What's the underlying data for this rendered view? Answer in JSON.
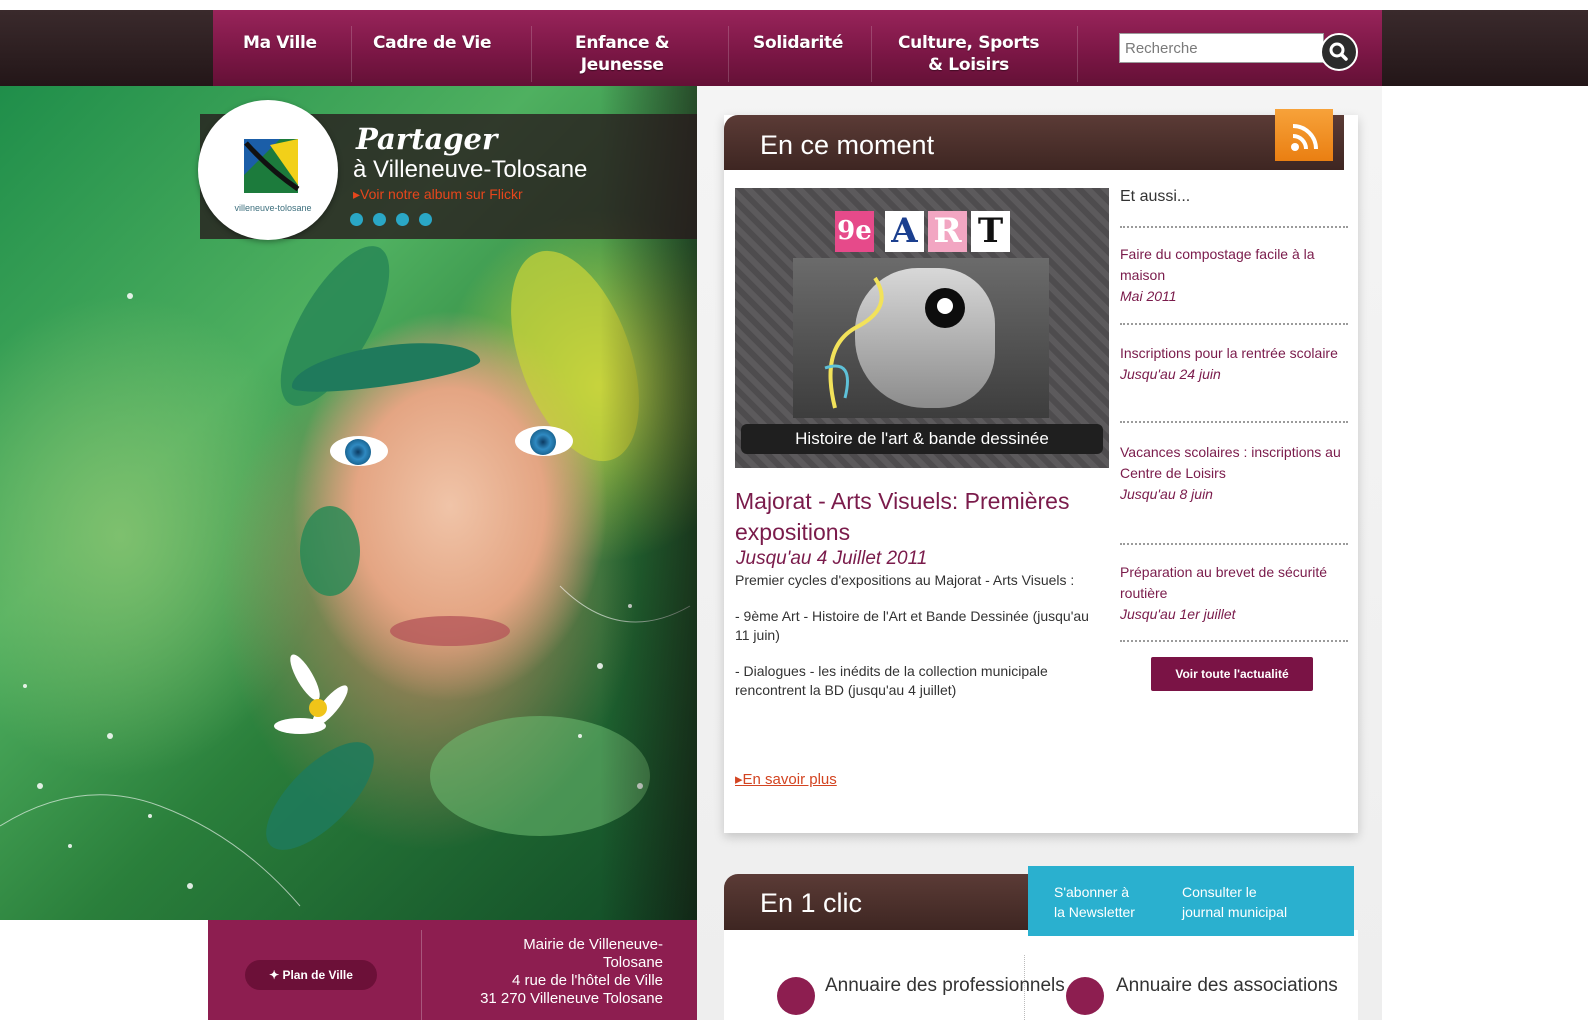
{
  "nav": {
    "items": [
      "Ma Ville",
      "Cadre de Vie",
      "Enfance &\nJeunesse",
      "Solidarité",
      "Culture, Sports\n& Loisirs"
    ],
    "search_placeholder": "Recherche"
  },
  "hero": {
    "logo_caption": "villeneuve-tolosane",
    "title": "Partager",
    "subtitle": "à Villeneuve-Tolosane",
    "flickr_link": "Voir notre album sur Flickr",
    "plan_button": "Plan de Ville",
    "address": [
      "Mairie de Villeneuve-",
      "Tolosane",
      "4 rue de l'hôtel de Ville",
      "31 270 Villeneuve Tolosane"
    ]
  },
  "moment": {
    "title": "En ce moment",
    "image": {
      "superscript": "9e",
      "letters": [
        "A",
        "R",
        "T"
      ],
      "caption": "Histoire de l'art & bande dessinée"
    },
    "feature": {
      "title": "Majorat - Arts Visuels: Premières expositions",
      "date": "Jusqu'au 4 Juillet 2011",
      "paragraphs": [
        "Premier cycles d'expositions au Majorat - Arts Visuels :",
        "- 9ème Art - Histoire de l'Art et Bande Dessinée (jusqu'au 11 juin)",
        "- Dialogues - les inédits de la collection municipale rencontrent la BD (jusqu'au 4 juillet)"
      ],
      "more_link": "En savoir plus"
    },
    "aussi": {
      "heading": "Et aussi...",
      "items": [
        {
          "title": "Faire du compostage facile à la maison",
          "date": "Mai 2011"
        },
        {
          "title": "Inscriptions pour la rentrée scolaire",
          "date": "Jusqu'au 24 juin"
        },
        {
          "title": "Vacances scolaires : inscriptions au Centre de Loisirs",
          "date": "Jusqu'au 8 juin"
        },
        {
          "title": "Préparation au brevet de sécurité routière",
          "date": "Jusqu'au 1er juillet"
        }
      ],
      "button": "Voir toute l'actualité"
    }
  },
  "clic": {
    "title": "En 1 clic",
    "links": [
      "S'abonner à\nla Newsletter",
      "Consulter le\njournal municipal"
    ],
    "annuaires": [
      "Annuaire des professionnels",
      "Annuaire des associations"
    ]
  },
  "colors": {
    "nav": "#7c1746",
    "brown_header": "#4a2f2b",
    "accent_link": "#d34421",
    "blue": "#2ab0cf",
    "rss": "#f39322"
  }
}
